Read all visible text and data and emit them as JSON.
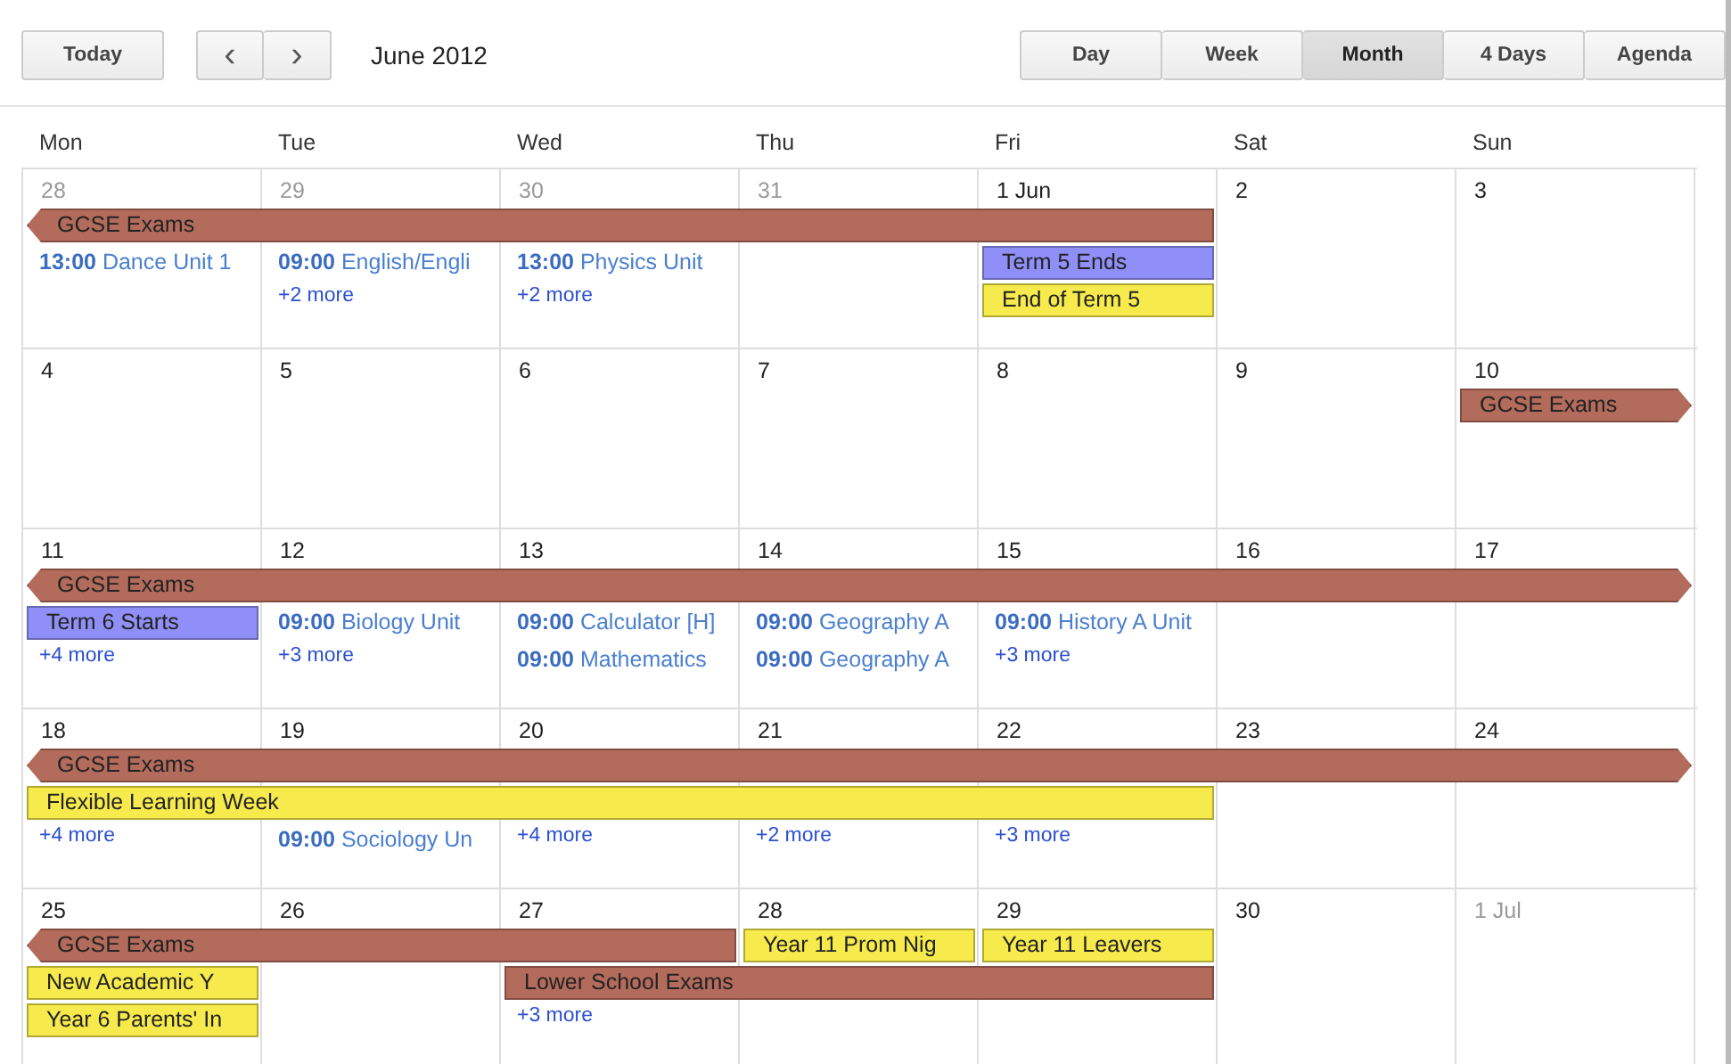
{
  "toolbar": {
    "today": "Today",
    "prev": "‹",
    "next": "›",
    "period": "June 2012"
  },
  "views": [
    {
      "label": "Day",
      "selected": false
    },
    {
      "label": "Week",
      "selected": false
    },
    {
      "label": "Month",
      "selected": true
    },
    {
      "label": "4 Days",
      "selected": false
    },
    {
      "label": "Agenda",
      "selected": false
    }
  ],
  "weekdays": [
    "Mon",
    "Tue",
    "Wed",
    "Thu",
    "Fri",
    "Sat",
    "Sun"
  ],
  "weeks": [
    {
      "days": [
        {
          "label": "28",
          "other_month": true,
          "items": [
            {
              "kind": "bar",
              "text": "GCSE Exams",
              "color": "#b36b5c",
              "continues_before": true,
              "continues_after": false
            },
            {
              "kind": "timed",
              "text": "**13:00** Dance Unit 1"
            }
          ]
        },
        {
          "label": "29",
          "other_month": true,
          "items": [
            {
              "kind": "continued"
            },
            {
              "kind": "timed",
              "text": "**09:00** English/Engli"
            },
            {
              "kind": "more",
              "text": "+2 more"
            }
          ]
        },
        {
          "label": "30",
          "other_month": true,
          "items": [
            {
              "kind": "continued"
            },
            {
              "kind": "timed",
              "text": "**13:00** Physics Unit"
            },
            {
              "kind": "more",
              "text": "+2 more"
            }
          ]
        },
        {
          "label": "31",
          "other_month": true,
          "items": [
            {
              "kind": "continued"
            }
          ]
        },
        {
          "label": "1 Jun",
          "other_month": false,
          "items": [
            {
              "kind": "continued"
            },
            {
              "kind": "bar",
              "text": "Term 5 Ends",
              "color": "#8f8ff7",
              "continues_before": false,
              "continues_after": false
            },
            {
              "kind": "bar",
              "text": "End of Term 5",
              "color": "#f6ea4c",
              "continues_before": false,
              "continues_after": false
            }
          ]
        },
        {
          "label": "2",
          "other_month": false
        },
        {
          "label": "3",
          "other_month": false
        }
      ]
    },
    {
      "days": [
        {
          "label": "4",
          "other_month": false
        },
        {
          "label": "5",
          "other_month": false
        },
        {
          "label": "6",
          "other_month": false
        },
        {
          "label": "7",
          "other_month": false
        },
        {
          "label": "8",
          "other_month": false
        },
        {
          "label": "9",
          "other_month": false
        },
        {
          "label": "10",
          "other_month": false,
          "items": [
            {
              "kind": "bar",
              "text": "GCSE Exams",
              "color": "#b36b5c",
              "continues_before": false,
              "continues_after": true
            }
          ]
        }
      ]
    },
    {
      "days": [
        {
          "label": "11",
          "other_month": false,
          "items": [
            {
              "kind": "bar",
              "text": "GCSE Exams",
              "color": "#b36b5c",
              "continues_before": true,
              "continues_after": true
            },
            {
              "kind": "bar",
              "text": "Term 6 Starts",
              "color": "#8f8ff7",
              "continues_before": false,
              "continues_after": false
            },
            {
              "kind": "more",
              "text": "+4 more"
            }
          ]
        },
        {
          "label": "12",
          "other_month": false,
          "items": [
            {
              "kind": "continued"
            },
            {
              "kind": "timed",
              "text": "**09:00** Biology Unit"
            },
            {
              "kind": "more",
              "text": "+3 more"
            }
          ]
        },
        {
          "label": "13",
          "other_month": false,
          "items": [
            {
              "kind": "continued"
            },
            {
              "kind": "timed",
              "text": "**09:00** Calculator [H]"
            },
            {
              "kind": "timed",
              "text": "**09:00** Mathematics"
            }
          ]
        },
        {
          "label": "14",
          "other_month": false,
          "items": [
            {
              "kind": "continued"
            },
            {
              "kind": "timed",
              "text": "**09:00** Geography A"
            },
            {
              "kind": "timed",
              "text": "**09:00** Geography A"
            }
          ]
        },
        {
          "label": "15",
          "other_month": false,
          "items": [
            {
              "kind": "continued"
            },
            {
              "kind": "timed",
              "text": "**09:00** History A Unit"
            },
            {
              "kind": "more",
              "text": "+3 more"
            }
          ]
        },
        {
          "label": "16",
          "other_month": false,
          "items": [
            {
              "kind": "continued"
            }
          ]
        },
        {
          "label": "17",
          "other_month": false,
          "items": [
            {
              "kind": "continued"
            }
          ]
        }
      ]
    },
    {
      "days": [
        {
          "label": "18",
          "other_month": false,
          "items": [
            {
              "kind": "bar",
              "text": "GCSE Exams",
              "color": "#b36b5c",
              "continues_before": true,
              "continues_after": true
            },
            {
              "kind": "bar",
              "text": "Flexible Learning Week",
              "color": "#f6ea4c",
              "continues_before": false,
              "continues_after": false
            },
            {
              "kind": "more",
              "text": "+4 more"
            }
          ]
        },
        {
          "label": "19",
          "other_month": false,
          "items": [
            {
              "kind": "continued"
            },
            {
              "kind": "continued"
            },
            {
              "kind": "timed",
              "text": "**09:00** Sociology Un"
            }
          ]
        },
        {
          "label": "20",
          "other_month": false,
          "items": [
            {
              "kind": "continued"
            },
            {
              "kind": "continued"
            },
            {
              "kind": "more",
              "text": "+4 more"
            }
          ]
        },
        {
          "label": "21",
          "other_month": false,
          "items": [
            {
              "kind": "continued"
            },
            {
              "kind": "continued"
            },
            {
              "kind": "more",
              "text": "+2 more"
            }
          ]
        },
        {
          "label": "22",
          "other_month": false,
          "items": [
            {
              "kind": "continued"
            },
            {
              "kind": "continued"
            },
            {
              "kind": "more",
              "text": "+3 more"
            }
          ]
        },
        {
          "label": "23",
          "other_month": false,
          "items": [
            {
              "kind": "continued"
            }
          ]
        },
        {
          "label": "24",
          "other_month": false,
          "items": [
            {
              "kind": "continued"
            }
          ]
        }
      ]
    },
    {
      "days": [
        {
          "label": "25",
          "other_month": false,
          "items": [
            {
              "kind": "bar",
              "text": "GCSE Exams",
              "color": "#b36b5c",
              "continues_before": true,
              "continues_after": false
            },
            {
              "kind": "bar",
              "text": "New Academic Y",
              "color": "#f6ea4c",
              "continues_before": false,
              "continues_after": false
            },
            {
              "kind": "bar",
              "text": "Year 6 Parents' In",
              "color": "#f6ea4c",
              "continues_before": false,
              "continues_after": false
            }
          ]
        },
        {
          "label": "26",
          "other_month": false,
          "items": [
            {
              "kind": "continued"
            }
          ]
        },
        {
          "label": "27",
          "other_month": false,
          "items": [
            {
              "kind": "continued"
            },
            {
              "kind": "bar",
              "text": "Lower School Exams",
              "color": "#b36b5c",
              "continues_before": false,
              "continues_after": false
            },
            {
              "kind": "more",
              "text": "+3 more"
            }
          ]
        },
        {
          "label": "28",
          "other_month": false,
          "items": [
            {
              "kind": "bar",
              "text": "Year 11 Prom Nig",
              "color": "#f6ea4c",
              "continues_before": false,
              "continues_after": false
            },
            {
              "kind": "continued"
            }
          ]
        },
        {
          "label": "29",
          "other_month": false,
          "items": [
            {
              "kind": "bar",
              "text": "Year 11 Leavers",
              "color": "#f6ea4c",
              "continues_before": false,
              "continues_after": false
            },
            {
              "kind": "continued"
            }
          ]
        },
        {
          "label": "30",
          "other_month": false
        },
        {
          "label": "1 Jul",
          "other_month": true
        }
      ]
    }
  ]
}
